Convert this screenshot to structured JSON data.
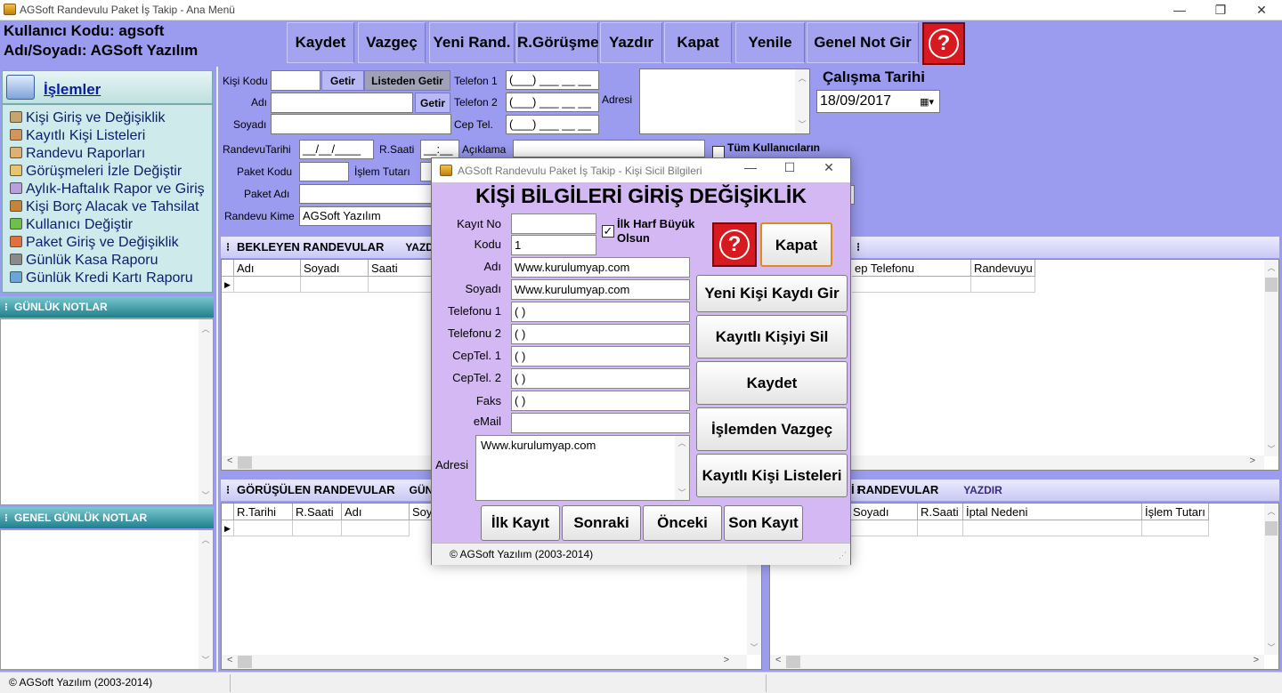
{
  "window": {
    "title": "AGSoft Randevulu Paket İş Takip - Ana Menü"
  },
  "header": {
    "user_code": "Kullanıcı Kodu: agsoft",
    "user_name": "Adı/Soyadı: AGSoft Yazılım",
    "buttons": [
      "Kaydet",
      "Vazgeç",
      "Yeni Rand.",
      "R.Görüşme",
      "Yazdır",
      "Kapat",
      "Yenile",
      "Genel Not Gir"
    ],
    "help": "?"
  },
  "sidebar": {
    "title": "İşlemler",
    "items": [
      {
        "label": "Kişi Giriş ve Değişiklik",
        "icon": "person-edit-icon"
      },
      {
        "label": "Kayıtlı Kişi Listeleri",
        "icon": "list-icon"
      },
      {
        "label": "Randevu Raporları",
        "icon": "report-icon"
      },
      {
        "label": "Görüşmeleri İzle Değiştir",
        "icon": "pencil-icon"
      },
      {
        "label": "Aylık-Haftalık Rapor ve Giriş",
        "icon": "report-edit-icon"
      },
      {
        "label": "Kişi Borç Alacak ve Tahsilat",
        "icon": "wallet-icon"
      },
      {
        "label": "Kullanıcı Değiştir",
        "icon": "user-switch-icon"
      },
      {
        "label": "Paket Giriş ve Değişiklik",
        "icon": "package-icon"
      },
      {
        "label": "Günlük Kasa Raporu",
        "icon": "cash-icon"
      },
      {
        "label": "Günlük Kredi Kartı Raporu",
        "icon": "card-icon"
      }
    ],
    "daily_notes": "GÜNLÜK NOTLAR",
    "general_notes": "GENEL GÜNLÜK NOTLAR"
  },
  "form": {
    "kisi_kodu": "Kişi Kodu",
    "getir": "Getir",
    "listeden_getir": "Listeden Getir",
    "adi": "Adı",
    "soyadi": "Soyadı",
    "telefon1": "Telefon 1",
    "telefon2": "Telefon 2",
    "cep_tel": "Cep Tel.",
    "phone_mask": "(___) ___ __ __",
    "adresi": "Adresi",
    "calisma_tarihi": "Çalışma Tarihi",
    "calisma_tarihi_value": "18/09/2017",
    "randevu_tarihi": "RandevuTarihi",
    "date_mask": "__/__/____",
    "r_saati": "R.Saati",
    "time_mask": "__:__",
    "aciklama": "Açıklama",
    "tum_kullanicilar": "Tüm Kullanıcıların",
    "paket_kodu": "Paket Kodu",
    "islem_tutari": "İşlem Tutarı",
    "paket_adi": "Paket Adı",
    "randevu_kime": "Randevu Kime",
    "randevu_kime_value": "AGSoft Yazılım"
  },
  "grids": {
    "bekleyen": {
      "title": "BEKLEYEN RANDEVULAR",
      "print": "YAZDIR",
      "cols": [
        "Adı",
        "Soyadı",
        "Saati"
      ],
      "right_cols": [
        "ep Telefonu",
        "Randevuyu"
      ]
    },
    "gorusulen": {
      "title": "GÖRÜŞÜLEN RANDEVULAR",
      "print": "GÜNC",
      "cols": [
        "R.Tarihi",
        "R.Saati",
        "Adı",
        "Soy"
      ]
    },
    "iptal": {
      "title": "İ RANDEVULAR",
      "print": "YAZDIR",
      "cols": [
        "Soyadı",
        "R.Saati",
        "İptal Nedeni",
        "İşlem Tutarı"
      ]
    }
  },
  "status": {
    "copyright": "© AGSoft Yazılım (2003-2014)"
  },
  "dialog": {
    "title": "AGSoft Randevulu Paket İş Takip - Kişi Sicil Bilgileri",
    "heading": "KİŞİ BİLGİLERİ GİRİŞ DEĞİŞİKLİK",
    "fields": {
      "kayit_no": {
        "label": "Kayıt No",
        "value": ""
      },
      "kodu": {
        "label": "Kodu",
        "value": "1"
      },
      "adi": {
        "label": "Adı",
        "value": "Www.kurulumyap.com"
      },
      "soyadi": {
        "label": "Soyadı",
        "value": "Www.kurulumyap.com"
      },
      "telefonu1": {
        "label": "Telefonu 1",
        "value": "(  )"
      },
      "telefonu2": {
        "label": "Telefonu 2",
        "value": "(  )"
      },
      "ceptel1": {
        "label": "CepTel. 1",
        "value": "(  )"
      },
      "ceptel2": {
        "label": "CepTel. 2",
        "value": "(  )"
      },
      "faks": {
        "label": "Faks",
        "value": "(  )"
      },
      "email": {
        "label": "eMail",
        "value": ""
      },
      "adresi": {
        "label": "Adresi",
        "value": "Www.kurulumyap.com"
      }
    },
    "ilk_harf": "İlk Harf Büyük Olsun",
    "ilk_harf_checked": true,
    "help": "?",
    "kapat": "Kapat",
    "actions": [
      "Yeni Kişi Kaydı Gir",
      "Kayıtlı Kişiyi Sil",
      "Kaydet",
      "İşlemden Vazgeç",
      "Kayıtlı Kişi Listeleri"
    ],
    "nav": [
      "İlk Kayıt",
      "Sonraki",
      "Önceki",
      "Son Kayıt"
    ],
    "status": "© AGSoft Yazılım (2003-2014)"
  }
}
